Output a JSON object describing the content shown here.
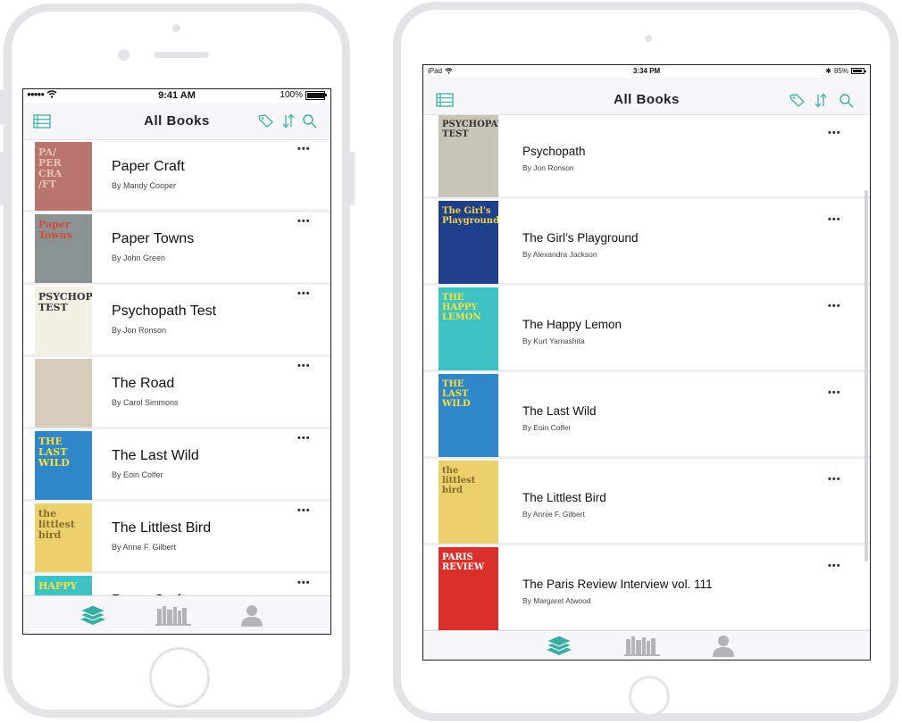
{
  "colors": {
    "accent": "#3aaea5",
    "inactive": "#b4b4b8",
    "frame": "#e4e4e6"
  },
  "phone": {
    "status": {
      "carrier": "●●●●● ",
      "time": "9:41 AM",
      "battery": "100%",
      "battery_fill": 1.0
    },
    "nav": {
      "title": "All Books",
      "icons": [
        "list-icon",
        "tag-icon",
        "sort-icon",
        "search-icon"
      ]
    },
    "books": [
      {
        "title": "Paper Craft",
        "author": "By Mandy Cooper",
        "cover_text": "PA/\nPER\nCRA\n/FT",
        "cover_color": "#b8756d",
        "cover_ink": "#e8c3b4"
      },
      {
        "title": "Paper Towns",
        "author": "By John Green",
        "cover_text": "Paper Towns",
        "cover_color": "#8a9391",
        "cover_ink": "#d44a3a"
      },
      {
        "title": "Psychopath Test",
        "author": "By Jon Ronson",
        "cover_text": "PSYCHOPATH\nTEST",
        "cover_color": "#f3f0e6",
        "cover_ink": "#333333"
      },
      {
        "title": "The Road",
        "author": "By Carol Simmons",
        "cover_text": "",
        "cover_color": "#d6cdbc",
        "cover_ink": "#b24a4a"
      },
      {
        "title": "The Last Wild",
        "author": "By Eoin Colfer",
        "cover_text": "THE\nLAST\nWILD",
        "cover_color": "#2f86c8",
        "cover_ink": "#f7e03c"
      },
      {
        "title": "The Littlest Bird",
        "author": "By Anne F. Gilbert",
        "cover_text": "the\nlittlest\nbird",
        "cover_color": "#ecd06e",
        "cover_ink": "#8b6b2a"
      },
      {
        "title": "Paper Craft",
        "author": "",
        "cover_text": "HAPPY",
        "cover_color": "#3fc2c4",
        "cover_ink": "#f5e23a"
      }
    ],
    "tabs": [
      {
        "name": "books-tab",
        "icon": "books-stack-icon",
        "active": true
      },
      {
        "name": "library-tab",
        "icon": "shelf-icon",
        "active": false
      },
      {
        "name": "profile-tab",
        "icon": "person-icon",
        "active": false
      }
    ]
  },
  "tablet": {
    "status": {
      "carrier": "iPad",
      "time": "3:34 PM",
      "battery": "85%",
      "battery_fill": 0.85
    },
    "nav": {
      "title": "All Books",
      "icons": [
        "list-icon",
        "tag-icon",
        "sort-icon",
        "search-icon"
      ]
    },
    "books": [
      {
        "title": "Psychopath",
        "author": "By Jon Ronson",
        "cover_text": "PSYCHOPATH\nTEST",
        "cover_color": "#c9c4b8",
        "cover_ink": "#333333"
      },
      {
        "title": "The Girl’s Playground",
        "author": "By Alexandra Jackson",
        "cover_text": "The Girl's\nPlayground",
        "cover_color": "#1e3f8a",
        "cover_ink": "#f0d24a"
      },
      {
        "title": "The Happy Lemon",
        "author": "By Kurt Yamashita",
        "cover_text": "THE\nHAPPY\nLEMON",
        "cover_color": "#3fc2c4",
        "cover_ink": "#f5e23a"
      },
      {
        "title": "The Last Wild",
        "author": "By Eoin Colfer",
        "cover_text": "THE\nLAST\nWILD",
        "cover_color": "#2f86c8",
        "cover_ink": "#f7e03c"
      },
      {
        "title": "The Littlest Bird",
        "author": "By Annie F. Gilbert",
        "cover_text": "the\nlittlest\nbird",
        "cover_color": "#ecd06e",
        "cover_ink": "#8b6b2a"
      },
      {
        "title": "The Paris Review Interview vol. 111",
        "author": "By Margaret Atwood",
        "cover_text": "PARIS\nREVIEW",
        "cover_color": "#d9302b",
        "cover_ink": "#ffffff"
      }
    ],
    "tabs": [
      {
        "name": "books-tab",
        "icon": "books-stack-icon",
        "active": true
      },
      {
        "name": "library-tab",
        "icon": "shelf-icon",
        "active": false
      },
      {
        "name": "profile-tab",
        "icon": "person-icon",
        "active": false
      }
    ]
  },
  "more_label": "•••"
}
